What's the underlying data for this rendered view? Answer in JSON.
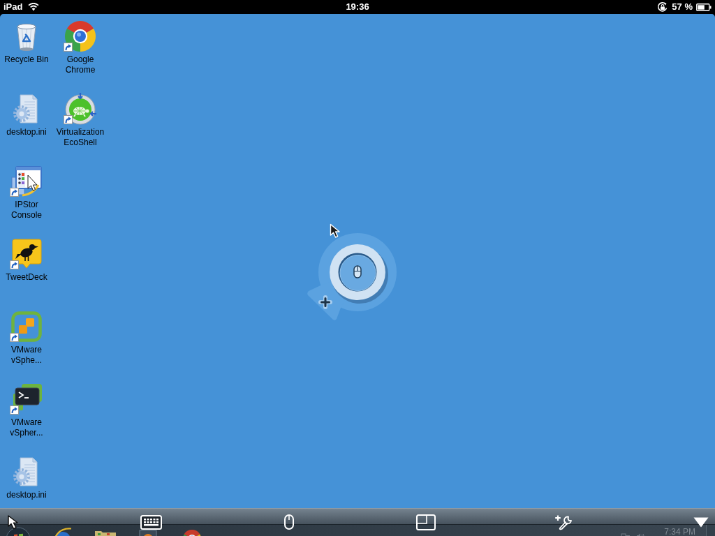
{
  "status_bar": {
    "device": "iPad",
    "time": "19:36",
    "battery_text": "57 %"
  },
  "desktop": {
    "icons": [
      {
        "label": "Recycle Bin",
        "kind": "recycle",
        "shortcut": false
      },
      {
        "label": "desktop.ini",
        "kind": "ini",
        "shortcut": false
      },
      {
        "label": "IPStor Console",
        "kind": "ipstor",
        "shortcut": true
      },
      {
        "label": "TweetDeck",
        "kind": "tweetdeck",
        "shortcut": true
      },
      {
        "label": "VMware vSphe...",
        "kind": "vsphere",
        "shortcut": true
      },
      {
        "label": "VMware vSpher...",
        "kind": "powercli",
        "shortcut": true
      },
      {
        "label": "desktop.ini",
        "kind": "ini",
        "shortcut": false
      },
      {
        "label": "Google Chrome",
        "kind": "chrome",
        "shortcut": true
      },
      {
        "label": "Virtualization EcoShell",
        "kind": "ecoshell",
        "shortcut": true
      }
    ]
  },
  "taskbar": {
    "clock": "7:34 PM"
  }
}
